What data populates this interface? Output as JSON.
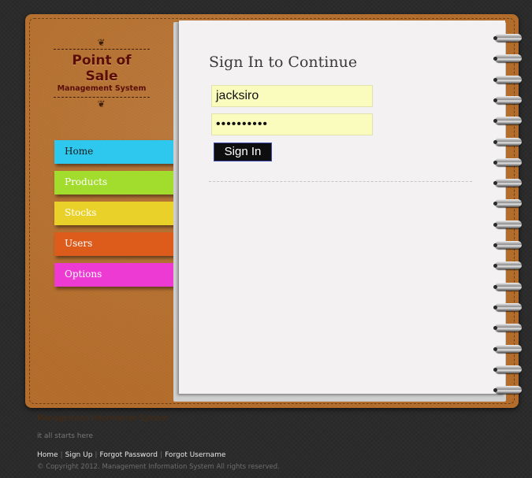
{
  "logo": {
    "title": "Point of Sale",
    "subtitle": "Management System"
  },
  "nav": {
    "items": [
      {
        "label": "Home"
      },
      {
        "label": "Products"
      },
      {
        "label": "Stocks"
      },
      {
        "label": "Users"
      },
      {
        "label": "Options"
      }
    ]
  },
  "form": {
    "title": "Sign In to Continue",
    "username_value": "jacksiro",
    "password_value": "••••••••••",
    "signin_label": "Sign In"
  },
  "footer": {
    "brand": "Management Information System",
    "tagline": "it all starts here",
    "links": [
      {
        "label": "Home"
      },
      {
        "label": "Sign Up"
      },
      {
        "label": "Forgot Password"
      },
      {
        "label": "Forgot Username"
      }
    ],
    "copyright": "© Copyright 2012. Management Information System All rights reserved."
  },
  "colors": {
    "leather": "#b56e2c",
    "paper": "#f4f1f2",
    "tab_home": "#2ec8ee",
    "tab_products": "#a2dc2c",
    "tab_stocks": "#ead12a",
    "tab_users": "#dd5c1c",
    "tab_options": "#ec3ad2",
    "input_bg": "#fafcbe"
  }
}
